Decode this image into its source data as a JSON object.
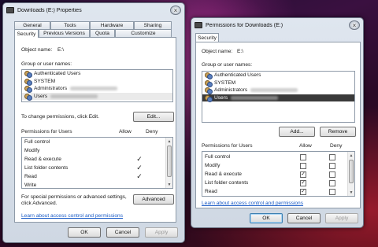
{
  "win1": {
    "title": "Downloads (E:) Properties",
    "tabs_row1": [
      "General",
      "Tools",
      "Hardware",
      "Sharing"
    ],
    "tabs_row2": [
      "Security",
      "Previous Versions",
      "Quota",
      "Customize"
    ],
    "object_name_label": "Object name:",
    "object_name_value": "E:\\",
    "group_label": "Group or user names:",
    "users": [
      "Authenticated Users",
      "SYSTEM",
      "Administrators",
      "Users"
    ],
    "change_text": "To change permissions, click Edit.",
    "edit_button": "Edit...",
    "perm_label": "Permissions for Users",
    "allow": "Allow",
    "deny": "Deny",
    "permissions": [
      {
        "name": "Full control",
        "allow": false,
        "deny": false
      },
      {
        "name": "Modify",
        "allow": false,
        "deny": false
      },
      {
        "name": "Read & execute",
        "allow": true,
        "deny": false
      },
      {
        "name": "List folder contents",
        "allow": true,
        "deny": false
      },
      {
        "name": "Read",
        "allow": true,
        "deny": false
      },
      {
        "name": "Write",
        "allow": false,
        "deny": false
      }
    ],
    "special_text_1": "For special permissions or advanced settings,",
    "special_text_2": "click Advanced.",
    "advanced_button": "Advanced",
    "learn_link": "Learn about access control and permissions",
    "ok": "OK",
    "cancel": "Cancel",
    "apply": "Apply"
  },
  "win2": {
    "title": "Permissions for Downloads (E:)",
    "tab": "Security",
    "object_name_label": "Object name:",
    "object_name_value": "E:\\",
    "group_label": "Group or user names:",
    "users": [
      "Authenticated Users",
      "SYSTEM",
      "Administrators",
      "Users"
    ],
    "add_button": "Add...",
    "remove_button": "Remove",
    "perm_label": "Permissions for Users",
    "allow": "Allow",
    "deny": "Deny",
    "permissions": [
      {
        "name": "Full control",
        "allow": false,
        "deny": false
      },
      {
        "name": "Modify",
        "allow": false,
        "deny": false
      },
      {
        "name": "Read & execute",
        "allow": true,
        "deny": false
      },
      {
        "name": "List folder contents",
        "allow": true,
        "deny": false
      },
      {
        "name": "Read",
        "allow": true,
        "deny": false
      }
    ],
    "learn_link": "Learn about access control and permissions",
    "ok": "OK",
    "cancel": "Cancel",
    "apply": "Apply"
  }
}
